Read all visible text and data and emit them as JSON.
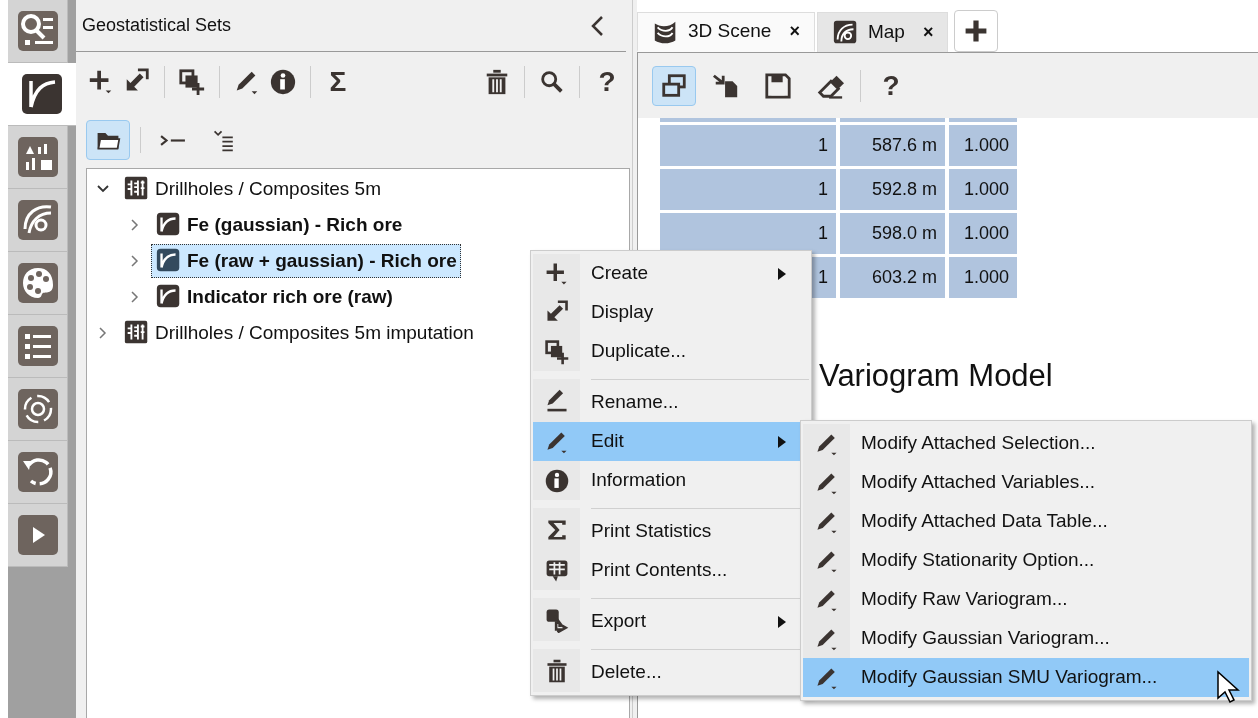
{
  "side_strip": [
    {
      "kind": "search-list",
      "selected": false
    },
    {
      "kind": "variogram",
      "selected": true
    },
    {
      "kind": "charts",
      "selected": false
    },
    {
      "kind": "map",
      "selected": false
    },
    {
      "kind": "palette",
      "selected": false
    },
    {
      "kind": "list",
      "selected": false
    },
    {
      "kind": "target",
      "selected": false
    },
    {
      "kind": "undo",
      "selected": false
    },
    {
      "kind": "play",
      "selected": false
    }
  ],
  "panel": {
    "title": "Geostatistical Sets",
    "toolbar": [
      {
        "kind": "plus"
      },
      {
        "kind": "display"
      },
      {
        "kind": "sep"
      },
      {
        "kind": "duplicate"
      },
      {
        "kind": "sep"
      },
      {
        "kind": "pencil"
      },
      {
        "kind": "info"
      },
      {
        "kind": "sep"
      },
      {
        "kind": "text",
        "label": "Σ"
      },
      {
        "kind": "spacer"
      },
      {
        "kind": "trash"
      },
      {
        "kind": "sep"
      },
      {
        "kind": "search"
      },
      {
        "kind": "sep"
      },
      {
        "kind": "text",
        "label": "?"
      }
    ],
    "view_toolbar": [
      {
        "kind": "folder",
        "selected": true
      },
      {
        "kind": "collapse",
        "selected": false
      },
      {
        "kind": "expand",
        "selected": false
      }
    ],
    "tree": [
      {
        "label": "Drillholes / Composites 5m",
        "kind": "table",
        "expanded": true,
        "selected": false,
        "children": [
          {
            "label": "Fe (gaussian) - Rich ore",
            "kind": "variogram",
            "expanded": false,
            "selected": false
          },
          {
            "label": "Fe (raw + gaussian) - Rich ore",
            "kind": "variogram",
            "expanded": false,
            "selected": true
          },
          {
            "label": "Indicator rich ore (raw)",
            "kind": "variogram",
            "expanded": false,
            "selected": false
          }
        ]
      },
      {
        "label": "Drillholes / Composites 5m imputation",
        "kind": "table",
        "expanded": false,
        "selected": false
      }
    ]
  },
  "tabs": [
    {
      "label": "3D Scene",
      "close": "×",
      "kind": "scene",
      "selected": true
    },
    {
      "label": "Map",
      "close": "×",
      "kind": "map",
      "selected": false
    }
  ],
  "view_toolbar": [
    {
      "kind": "windows",
      "selected": true
    },
    {
      "kind": "import",
      "selected": false
    },
    {
      "kind": "save",
      "selected": false
    },
    {
      "kind": "eraser",
      "selected": false
    },
    {
      "kind": "sep"
    },
    {
      "kind": "text",
      "label": "?",
      "selected": false
    }
  ],
  "table": {
    "rows": [
      [
        "1",
        "587.6 m",
        "1.000"
      ],
      [
        "1",
        "592.8 m",
        "1.000"
      ],
      [
        "1",
        "598.0 m",
        "1.000"
      ],
      [
        "1",
        "603.2 m",
        "1.000"
      ]
    ]
  },
  "heading": "Variogram Model",
  "context_menu": [
    {
      "label": "Create",
      "kind": "plus",
      "submenu": true,
      "highlighted": false,
      "separator_before": false
    },
    {
      "label": "Display",
      "kind": "display",
      "submenu": false,
      "highlighted": false,
      "separator_before": false
    },
    {
      "label": "Duplicate...",
      "kind": "duplicate",
      "submenu": false,
      "highlighted": false,
      "separator_before": false
    },
    {
      "label": "Rename...",
      "kind": "rename",
      "submenu": false,
      "highlighted": false,
      "separator_before": true
    },
    {
      "label": "Edit",
      "kind": "pencil",
      "submenu": true,
      "highlighted": true,
      "separator_before": false
    },
    {
      "label": "Information",
      "kind": "info",
      "submenu": false,
      "highlighted": false,
      "separator_before": false
    },
    {
      "label": "Print Statistics",
      "kind": "sigma",
      "submenu": false,
      "highlighted": false,
      "separator_before": true
    },
    {
      "label": "Print Contents...",
      "kind": "contents",
      "submenu": false,
      "highlighted": false,
      "separator_before": false
    },
    {
      "label": "Export",
      "kind": "export",
      "submenu": true,
      "highlighted": false,
      "separator_before": true
    },
    {
      "label": "Delete...",
      "kind": "trash",
      "submenu": false,
      "highlighted": false,
      "separator_before": true
    }
  ],
  "submenu": [
    {
      "label": "Modify Attached Selection...",
      "highlighted": false
    },
    {
      "label": "Modify Attached Variables...",
      "highlighted": false
    },
    {
      "label": "Modify Attached Data Table...",
      "highlighted": false
    },
    {
      "label": "Modify Stationarity Option...",
      "highlighted": false
    },
    {
      "label": "Modify Raw Variogram...",
      "highlighted": false
    },
    {
      "label": "Modify Gaussian Variogram...",
      "highlighted": false
    },
    {
      "label": "Modify Gaussian SMU Variogram...",
      "highlighted": true
    }
  ]
}
